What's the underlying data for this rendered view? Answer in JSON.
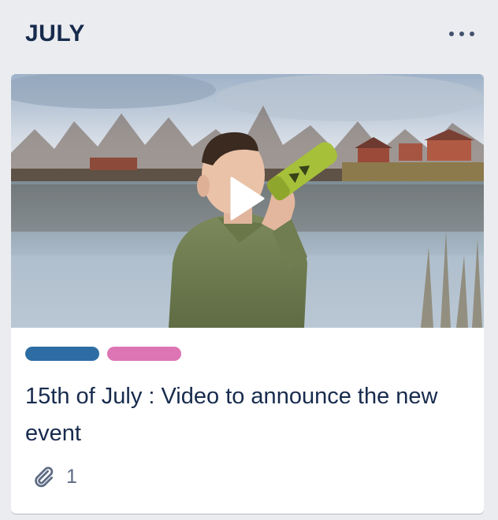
{
  "list": {
    "title": "JULY",
    "menu_icon": "more-horizontal-icon"
  },
  "card": {
    "cover_icon": "play-icon",
    "labels": [
      {
        "color": "#2e6da4"
      },
      {
        "color": "#dd74b4"
      }
    ],
    "title": "15th of July : Video to announce the new event",
    "badges": {
      "attachment_icon": "paperclip-icon",
      "attachments": "1"
    }
  },
  "colors": {
    "list_background": "#ebecf0",
    "card_background": "#ffffff",
    "text_primary": "#172b4d",
    "text_muted": "#5e6c84"
  }
}
